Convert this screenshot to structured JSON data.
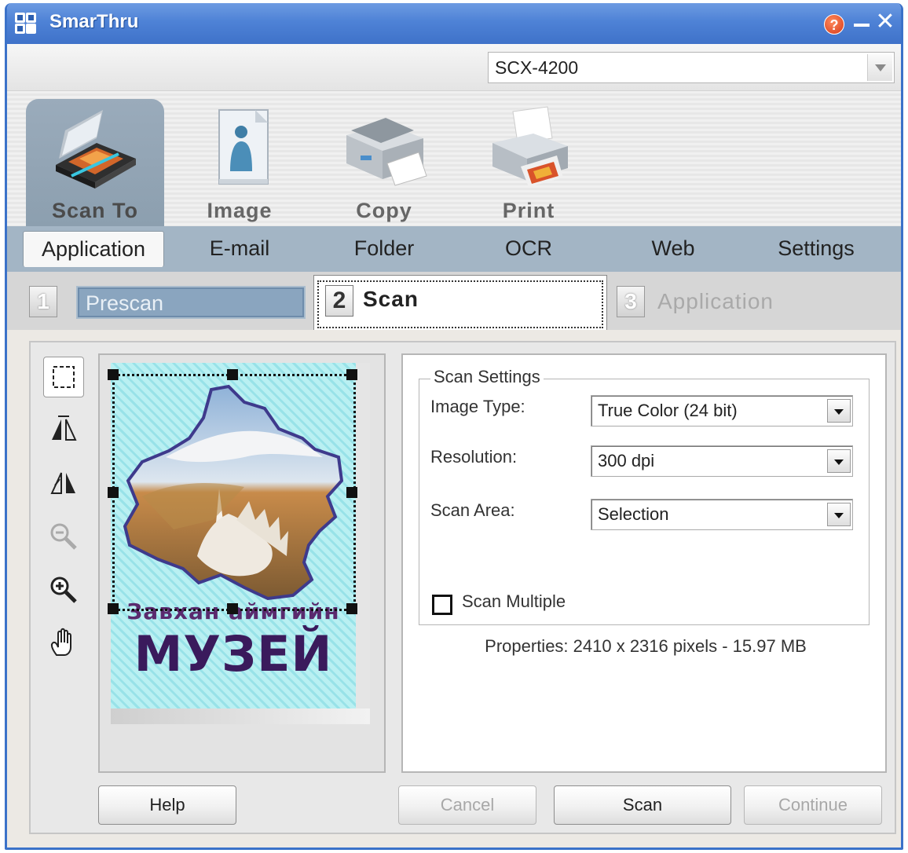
{
  "window": {
    "title": "SmarThru"
  },
  "titlebar": {
    "help_glyph": "?",
    "minimize_glyph": "_",
    "close_glyph": "✕"
  },
  "device": {
    "selected": "SCX-4200"
  },
  "tools": [
    {
      "label": "Scan To",
      "icon": "scanner-icon",
      "active": true
    },
    {
      "label": "Image",
      "icon": "image-icon",
      "active": false
    },
    {
      "label": "Copy",
      "icon": "copier-icon",
      "active": false
    },
    {
      "label": "Print",
      "icon": "printer-icon",
      "active": false
    }
  ],
  "subtabs": [
    {
      "label": "Application",
      "active": true
    },
    {
      "label": "E-mail",
      "active": false
    },
    {
      "label": "Folder",
      "active": false
    },
    {
      "label": "OCR",
      "active": false
    },
    {
      "label": "Web",
      "active": false
    },
    {
      "label": "Settings",
      "active": false
    }
  ],
  "steps": [
    {
      "num": "1",
      "label": "Prescan"
    },
    {
      "num": "2",
      "label": "Scan"
    },
    {
      "num": "3",
      "label": "Application"
    }
  ],
  "preview_tools": [
    "selection-icon",
    "flip-horizontal-icon",
    "flip-vertical-icon",
    "zoom-out-icon",
    "zoom-in-icon",
    "hand-pan-icon"
  ],
  "preview_image": {
    "text_line1": "Завхан аймгийн",
    "text_line2": "МУЗЕЙ"
  },
  "scan_settings": {
    "legend": "Scan Settings",
    "image_type_label": "Image Type:",
    "image_type_value": "True Color (24 bit)",
    "resolution_label": "Resolution:",
    "resolution_value": "300 dpi",
    "scan_area_label": "Scan Area:",
    "scan_area_value": "Selection",
    "scan_multiple_label": "Scan Multiple",
    "scan_multiple_checked": false
  },
  "properties": "Properties: 2410 x 2316 pixels - 15.97 MB",
  "buttons": {
    "help": "Help",
    "cancel": "Cancel",
    "scan": "Scan",
    "continue": "Continue"
  },
  "colors": {
    "titlebar": "#4e82d6",
    "subtab_bar": "#a3b5c5",
    "active_tool": "#9aabbb"
  }
}
